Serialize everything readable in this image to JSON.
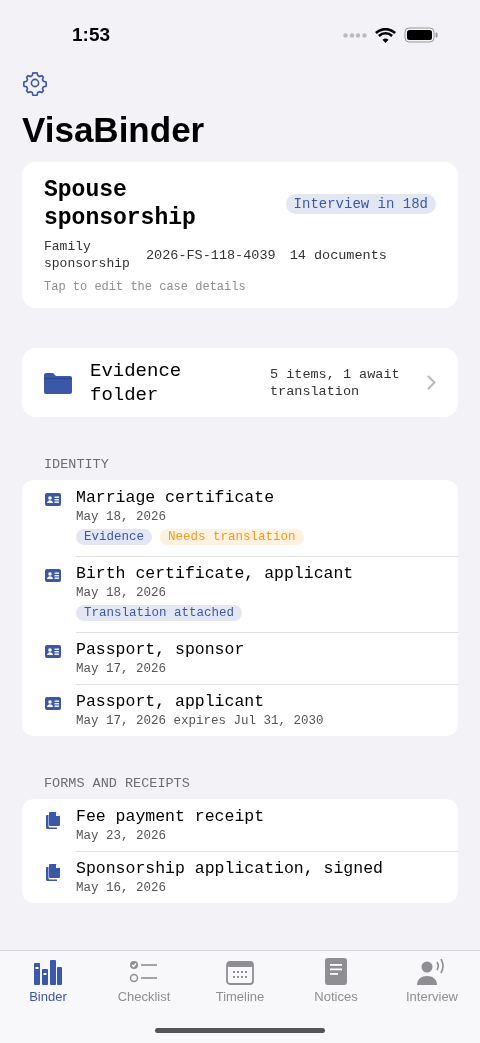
{
  "status_bar": {
    "time": "1:53"
  },
  "app_title": "VisaBinder",
  "case": {
    "title": "Spouse sponsorship",
    "badge": "Interview in 18d",
    "category": "Family sponsorship",
    "case_number": "2026-FS-118-4039",
    "document_count": "14 documents",
    "hint": "Tap to edit the case details"
  },
  "folder": {
    "title": "Evidence folder",
    "summary": "5 items, 1 await translation"
  },
  "sections": [
    {
      "title": "IDENTITY",
      "items": [
        {
          "kind": "id",
          "title": "Marriage certificate",
          "date": "May 18, 2026",
          "tags": [
            {
              "label": "Evidence",
              "color": "#3b57a8"
            },
            {
              "label": "Needs translation",
              "color": "#f29b1d"
            }
          ]
        },
        {
          "kind": "id",
          "title": "Birth certificate, applicant",
          "date": "May 18, 2026",
          "tags": [
            {
              "label": "Translation attached",
              "color": "#3b57a8"
            }
          ]
        },
        {
          "kind": "id",
          "title": "Passport, sponsor",
          "date": "May 17, 2026"
        },
        {
          "kind": "id",
          "title": "Passport, applicant",
          "date": "May 17, 2026 expires Jul 31, 2030"
        }
      ]
    },
    {
      "title": "FORMS AND RECEIPTS",
      "items": [
        {
          "kind": "document",
          "title": "Fee payment receipt",
          "date": "May 23, 2026"
        },
        {
          "kind": "document",
          "title": "Sponsorship application, signed",
          "date": "May 16, 2026"
        }
      ]
    }
  ],
  "tabs": [
    {
      "label": "Binder",
      "kind": "binder",
      "selected": true
    },
    {
      "label": "Checklist",
      "kind": "checklist",
      "selected": false
    },
    {
      "label": "Timeline",
      "kind": "timeline",
      "selected": false
    },
    {
      "label": "Notices",
      "kind": "notices",
      "selected": false
    },
    {
      "label": "Interview",
      "kind": "interview",
      "selected": false
    }
  ]
}
